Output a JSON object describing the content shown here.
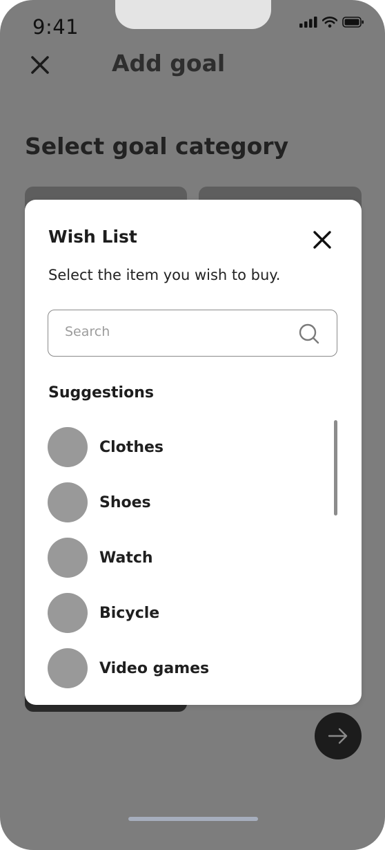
{
  "status_bar": {
    "time": "9:41",
    "icons": [
      "signal-icon",
      "wifi-icon",
      "battery-icon"
    ]
  },
  "header": {
    "title": "Add goal",
    "close_icon": "close-icon"
  },
  "page": {
    "section_title": "Select goal category"
  },
  "modal": {
    "title": "Wish List",
    "subtitle": "Select the item you wish to buy.",
    "search": {
      "placeholder": "Search",
      "value": ""
    },
    "suggestions_label": "Suggestions",
    "items": [
      {
        "label": "Clothes"
      },
      {
        "label": "Shoes"
      },
      {
        "label": "Watch"
      },
      {
        "label": "Bicycle"
      },
      {
        "label": "Video games"
      }
    ]
  },
  "colors": {
    "overlay_background": "#7d7d7d",
    "modal_background": "#ffffff",
    "fab_background": "#1c1c1c",
    "avatar_placeholder": "#999999",
    "home_indicator": "#a6aebd"
  }
}
